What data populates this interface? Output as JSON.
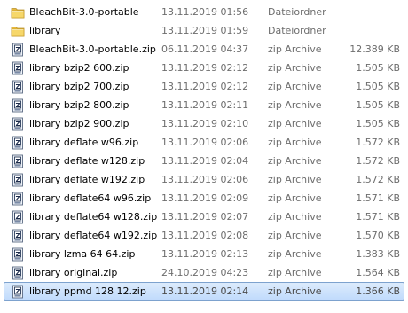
{
  "files": [
    {
      "name": "BleachBit-3.0-portable",
      "date": "13.11.2019 01:56",
      "type": "Dateiordner",
      "size": "",
      "icon": "folder-icon",
      "selected": false
    },
    {
      "name": "library",
      "date": "13.11.2019 01:59",
      "type": "Dateiordner",
      "size": "",
      "icon": "folder-icon",
      "selected": false
    },
    {
      "name": "BleachBit-3.0-portable.zip",
      "date": "06.11.2019 04:37",
      "type": "zip Archive",
      "size": "12.389 KB",
      "icon": "zip-archive-icon",
      "selected": false
    },
    {
      "name": "library bzip2 600.zip",
      "date": "13.11.2019 02:12",
      "type": "zip Archive",
      "size": "1.505 KB",
      "icon": "zip-archive-icon",
      "selected": false
    },
    {
      "name": "library bzip2 700.zip",
      "date": "13.11.2019 02:12",
      "type": "zip Archive",
      "size": "1.505 KB",
      "icon": "zip-archive-icon",
      "selected": false
    },
    {
      "name": "library bzip2 800.zip",
      "date": "13.11.2019 02:11",
      "type": "zip Archive",
      "size": "1.505 KB",
      "icon": "zip-archive-icon",
      "selected": false
    },
    {
      "name": "library bzip2 900.zip",
      "date": "13.11.2019 02:10",
      "type": "zip Archive",
      "size": "1.505 KB",
      "icon": "zip-archive-icon",
      "selected": false
    },
    {
      "name": "library deflate w96.zip",
      "date": "13.11.2019 02:06",
      "type": "zip Archive",
      "size": "1.572 KB",
      "icon": "zip-archive-icon",
      "selected": false
    },
    {
      "name": "library deflate w128.zip",
      "date": "13.11.2019 02:04",
      "type": "zip Archive",
      "size": "1.572 KB",
      "icon": "zip-archive-icon",
      "selected": false
    },
    {
      "name": "library deflate w192.zip",
      "date": "13.11.2019 02:06",
      "type": "zip Archive",
      "size": "1.572 KB",
      "icon": "zip-archive-icon",
      "selected": false
    },
    {
      "name": "library deflate64 w96.zip",
      "date": "13.11.2019 02:09",
      "type": "zip Archive",
      "size": "1.571 KB",
      "icon": "zip-archive-icon",
      "selected": false
    },
    {
      "name": "library deflate64 w128.zip",
      "date": "13.11.2019 02:07",
      "type": "zip Archive",
      "size": "1.571 KB",
      "icon": "zip-archive-icon",
      "selected": false
    },
    {
      "name": "library deflate64 w192.zip",
      "date": "13.11.2019 02:08",
      "type": "zip Archive",
      "size": "1.570 KB",
      "icon": "zip-archive-icon",
      "selected": false
    },
    {
      "name": "library lzma 64 64.zip",
      "date": "13.11.2019 02:13",
      "type": "zip Archive",
      "size": "1.383 KB",
      "icon": "zip-archive-icon",
      "selected": false
    },
    {
      "name": "library original.zip",
      "date": "24.10.2019 04:23",
      "type": "zip Archive",
      "size": "1.564 KB",
      "icon": "zip-archive-icon",
      "selected": false
    },
    {
      "name": "library ppmd 128 12.zip",
      "date": "13.11.2019 02:14",
      "type": "zip Archive",
      "size": "1.366 KB",
      "icon": "zip-archive-icon",
      "selected": true
    }
  ],
  "colors": {
    "selection_border": "#7da2ce",
    "selection_fill": "#cce3fc",
    "folder": "#f3cf58",
    "secondary_text": "#6d6d6d"
  }
}
